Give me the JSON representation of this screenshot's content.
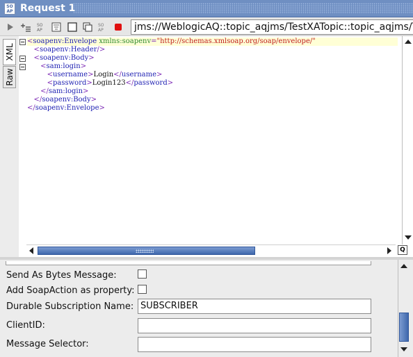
{
  "window": {
    "title": "Request 1",
    "icon": "soap-request-icon"
  },
  "toolbar": {
    "buttons": [
      "submit-play-icon",
      "add-endpoint-icon",
      "soap-ws-a-icon",
      "message-filter-icon",
      "split-view-icon",
      "clone-icon",
      "soap-wss-icon",
      "stop-icon"
    ],
    "endpoint": "jms://WeblogicAQ::topic_aqjms/TestXATopic::topic_aqjms/TestXATopic"
  },
  "tabs": {
    "xml": "XML",
    "raw": "Raw"
  },
  "editor": {
    "lines": [
      {
        "indent": "",
        "parts": [
          [
            "p",
            "<"
          ],
          [
            "t",
            "soapenv:Envelope"
          ],
          [
            "a",
            " xmlns:soapenv"
          ],
          [
            "p",
            "="
          ],
          [
            "v",
            "\"http://schemas.xmlsoap.org/soap/envelope/\""
          ]
        ]
      },
      {
        "indent": "   ",
        "parts": [
          [
            "p",
            "<"
          ],
          [
            "t",
            "soapenv:Header"
          ],
          [
            "p",
            "/>"
          ]
        ]
      },
      {
        "indent": "   ",
        "parts": [
          [
            "p",
            "<"
          ],
          [
            "t",
            "soapenv:Body"
          ],
          [
            "p",
            ">"
          ]
        ]
      },
      {
        "indent": "      ",
        "parts": [
          [
            "p",
            "<"
          ],
          [
            "t",
            "sam:login"
          ],
          [
            "p",
            ">"
          ]
        ]
      },
      {
        "indent": "         ",
        "parts": [
          [
            "p",
            "<"
          ],
          [
            "t",
            "username"
          ],
          [
            "p",
            ">"
          ],
          [
            "tx",
            "Login"
          ],
          [
            "p",
            "</"
          ],
          [
            "t",
            "username"
          ],
          [
            "p",
            ">"
          ]
        ]
      },
      {
        "indent": "         ",
        "parts": [
          [
            "p",
            "<"
          ],
          [
            "t",
            "password"
          ],
          [
            "p",
            ">"
          ],
          [
            "tx",
            "Login123"
          ],
          [
            "p",
            "</"
          ],
          [
            "t",
            "password"
          ],
          [
            "p",
            ">"
          ]
        ]
      },
      {
        "indent": "      ",
        "parts": [
          [
            "p",
            "</"
          ],
          [
            "t",
            "sam:login"
          ],
          [
            "p",
            ">"
          ]
        ]
      },
      {
        "indent": "   ",
        "parts": [
          [
            "p",
            "</"
          ],
          [
            "t",
            "soapenv:Body"
          ],
          [
            "p",
            ">"
          ]
        ]
      },
      {
        "indent": "",
        "parts": [
          [
            "p",
            "</"
          ],
          [
            "t",
            "soapenv:Envelope"
          ],
          [
            "p",
            ">"
          ]
        ]
      }
    ],
    "search_label": "Q"
  },
  "properties": {
    "send_as_bytes": {
      "label": "Send As Bytes Message:",
      "checked": false
    },
    "add_soapaction": {
      "label": "Add SoapAction as property:",
      "checked": false
    },
    "durable_subscription": {
      "label": "Durable Subscription Name:",
      "value": "SUBSCRIBER"
    },
    "client_id": {
      "label": "ClientID:",
      "value": ""
    },
    "message_selector": {
      "label": "Message Selector:",
      "value": ""
    }
  },
  "colors": {
    "titlebar": "#6f8fc2",
    "scroll_thumb": "#3f68ad",
    "stop": "#e01010"
  }
}
